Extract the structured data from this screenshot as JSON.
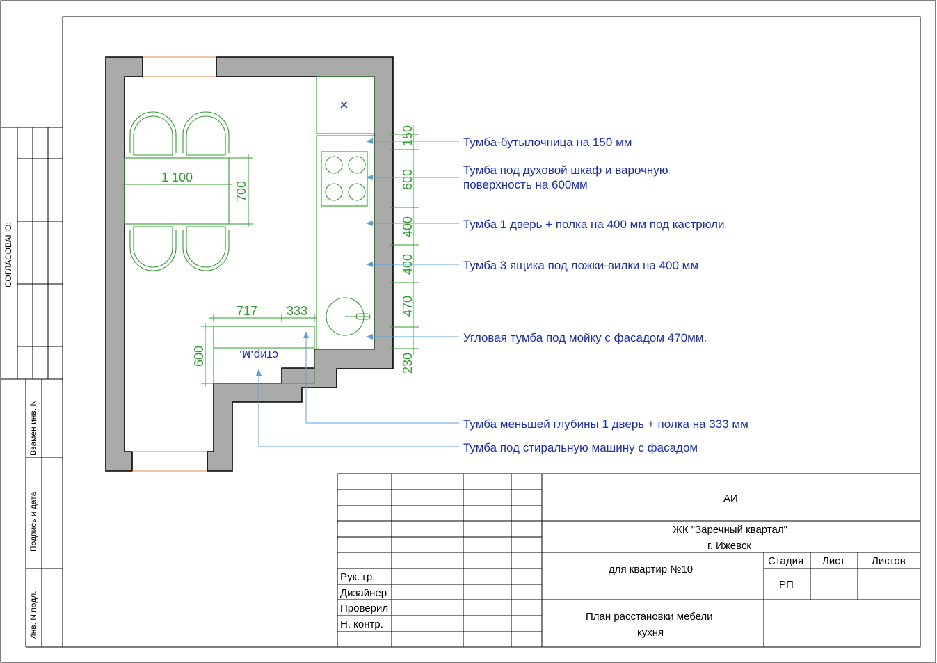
{
  "side": {
    "agreed": "СОГЛАСОВАНО:",
    "replace_inv": "Взамен инв. N",
    "sign_date": "Подпись и дата",
    "inv_orig": "Инв. N подл."
  },
  "dimensions": {
    "table_width": "1 100",
    "table_depth": "700",
    "stack": [
      "150",
      "600",
      "400",
      "400",
      "470",
      "230"
    ],
    "lower_717": "717",
    "lower_333": "333",
    "lower_600": "600"
  },
  "labels": {
    "washer": "стир.м."
  },
  "notes": {
    "bottle": "Тумба-бутылочница на 150 мм",
    "oven_1": "Тумба под духовой шкаф и варочную",
    "oven_2": "поверхность на 600мм",
    "pots": "Тумба 1 дверь + полка на 400 мм под кастрюли",
    "drawers": "Тумба 3 ящика под ложки-вилки на 400 мм",
    "sink": "Угловая тумба под мойку с фасадом 470мм.",
    "shallow": "Тумба меньшей глубины 1 дверь + полка на 333 мм",
    "washer": "Тумба под стиральную машину с фасадом"
  },
  "title_block": {
    "org": "АИ",
    "project_1": "ЖК \"Заречный квартал\"",
    "project_2": "г. Ижевск",
    "for": "для квартир №10",
    "stage_h": "Стадия",
    "sheet_h": "Лист",
    "sheets_h": "Листов",
    "stage": "РП",
    "drawing_1": "План расстановки мебели",
    "drawing_2": "кухня",
    "roles": [
      "Рук. гр.",
      "Дизайнер",
      "Проверил",
      "Н. контр."
    ]
  },
  "colors": {
    "wall": "#aaaaaa",
    "furniture": "#2e9e2e",
    "notes": "#1a2fb8",
    "leaders": "#5aa0dc"
  }
}
